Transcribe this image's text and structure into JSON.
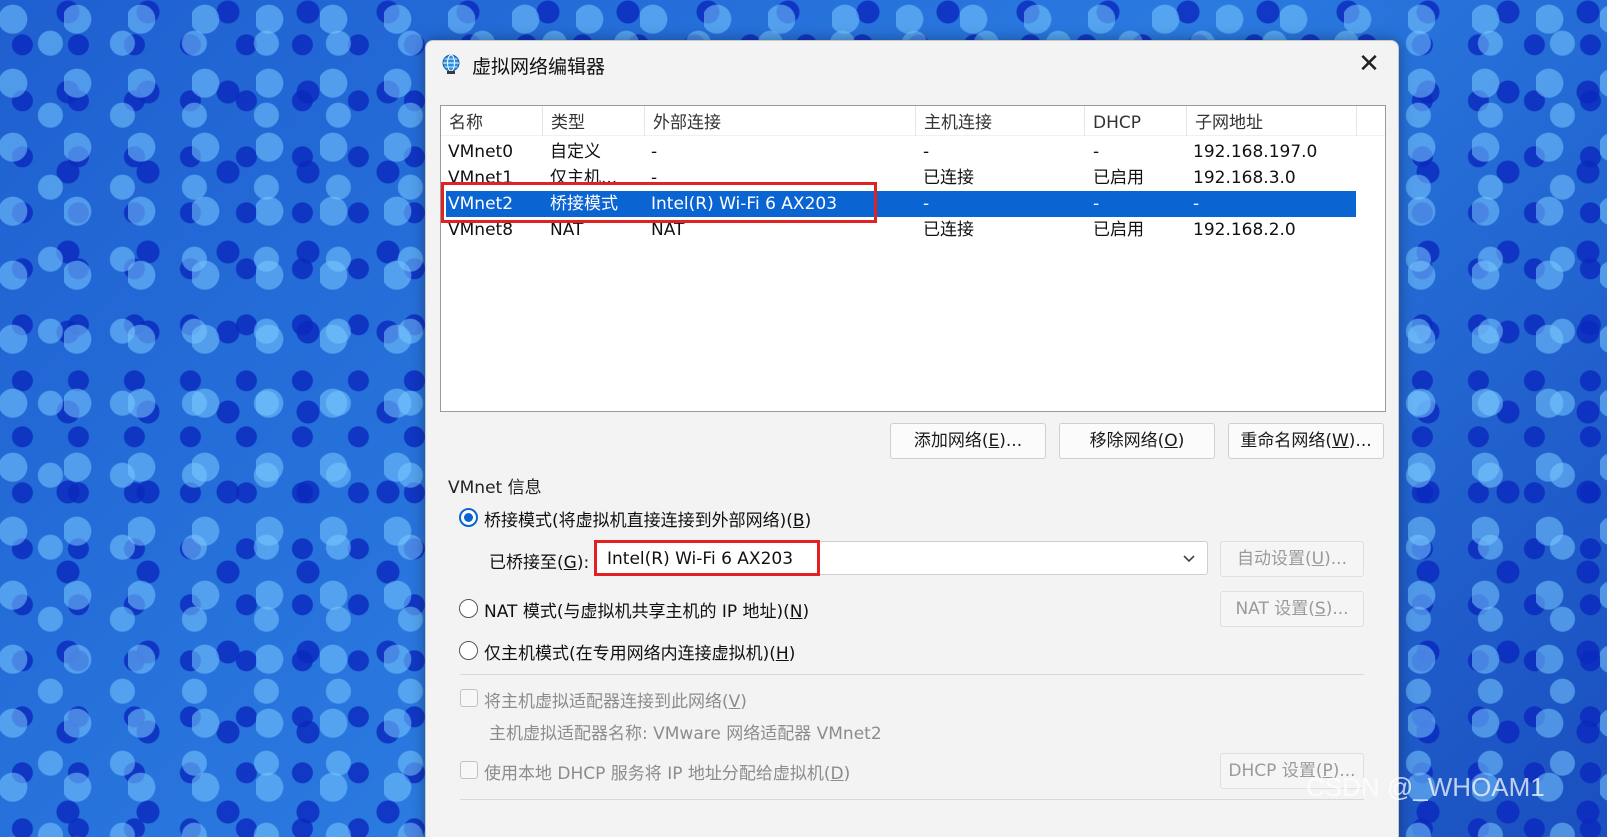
{
  "dialog": {
    "title": "虚拟网络编辑器",
    "icon": "globe-network-icon",
    "close_glyph": "✕"
  },
  "table": {
    "headers": [
      "名称",
      "类型",
      "外部连接",
      "主机连接",
      "DHCP",
      "子网地址"
    ],
    "rows": [
      {
        "name": "VMnet0",
        "type": "自定义",
        "external": "-",
        "host": "-",
        "dhcp": "-",
        "subnet": "192.168.197.0"
      },
      {
        "name": "VMnet1",
        "type": "仅主机...",
        "external": "-",
        "host": "已连接",
        "dhcp": "已启用",
        "subnet": "192.168.3.0"
      },
      {
        "name": "VMnet2",
        "type": "桥接模式",
        "external": "Intel(R) Wi-Fi 6 AX203",
        "host": "-",
        "dhcp": "-",
        "subnet": "-"
      },
      {
        "name": "VMnet8",
        "type": "NAT",
        "external": "NAT",
        "host": "已连接",
        "dhcp": "已启用",
        "subnet": "192.168.2.0"
      }
    ],
    "selected_index": 2
  },
  "buttons": {
    "add": {
      "text": "添加网络(",
      "key": "E",
      "suffix": ")..."
    },
    "remove": {
      "text": "移除网络(",
      "key": "O",
      "suffix": ")"
    },
    "rename": {
      "text": "重命名网络(",
      "key": "W",
      "suffix": ")..."
    }
  },
  "vmnet_info": {
    "group_title": "VMnet 信息",
    "bridged": {
      "text": "桥接模式(将虚拟机直接连接到外部网络)(",
      "key": "B",
      "suffix": ")",
      "checked": true
    },
    "bridged_to": {
      "text": "已桥接至(",
      "key": "G",
      "suffix": "):",
      "value": "Intel(R) Wi-Fi 6 AX203"
    },
    "auto_settings": {
      "text": "自动设置(",
      "key": "U",
      "suffix": ")..."
    },
    "nat": {
      "text": "NAT 模式(与虚拟机共享主机的 IP 地址)(",
      "key": "N",
      "suffix": ")",
      "checked": false
    },
    "nat_settings": {
      "text": "NAT 设置(",
      "key": "S",
      "suffix": ")..."
    },
    "host_only": {
      "text": "仅主机模式(在专用网络内连接虚拟机)(",
      "key": "H",
      "suffix": ")",
      "checked": false
    },
    "connect_adapter": {
      "text": "将主机虚拟适配器连接到此网络(",
      "key": "V",
      "suffix": ")",
      "checked": false
    },
    "adapter_name": "主机虚拟适配器名称: VMware 网络适配器 VMnet2",
    "use_dhcp": {
      "text": "使用本地 DHCP 服务将 IP 地址分配给虚拟机(",
      "key": "D",
      "suffix": ")",
      "checked": false
    },
    "dhcp_settings": {
      "text": "DHCP 设置(",
      "key": "P",
      "suffix": ")..."
    }
  },
  "watermark": "CSDN @_WHOAM1",
  "colors": {
    "selection": "#0a64d2",
    "highlight_box": "#e12222",
    "background": "#1f63c9"
  }
}
